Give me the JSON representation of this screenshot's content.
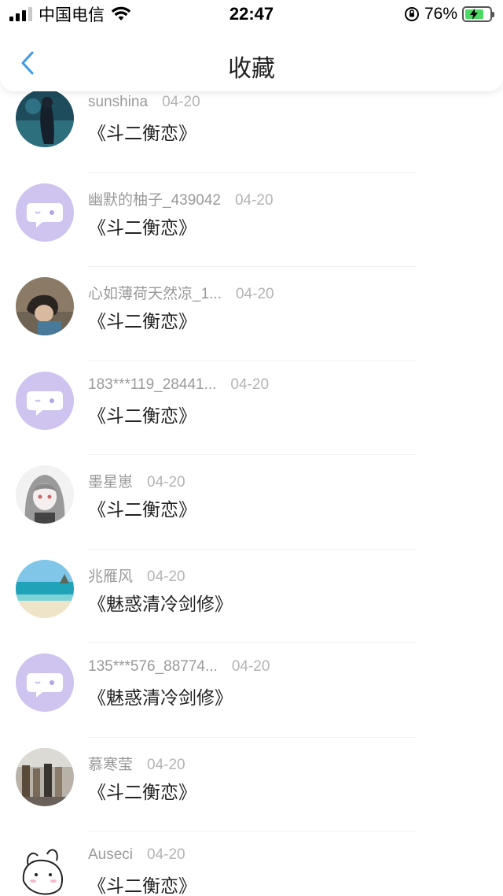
{
  "status_bar": {
    "carrier": "中国电信",
    "time": "22:47",
    "battery": "76%",
    "battery_level": 0.76
  },
  "header": {
    "title": "收藏",
    "back_icon": "chevron-left-icon"
  },
  "colors": {
    "accent": "#3d9be9",
    "placeholder_avatar": "#cfc3ef"
  },
  "items": [
    {
      "user": "sunshina",
      "date": "04-20",
      "title": "《斗二衡恋》",
      "avatar": "photo-dark-water"
    },
    {
      "user": "幽默的柚子_439042",
      "date": "04-20",
      "title": "《斗二衡恋》",
      "avatar": "default-chat-bubble"
    },
    {
      "user": "心如薄荷天然凉_1...",
      "date": "04-20",
      "title": "《斗二衡恋》",
      "avatar": "photo-person"
    },
    {
      "user": "183***119_28441...",
      "date": "04-20",
      "title": "《斗二衡恋》",
      "avatar": "default-chat-bubble"
    },
    {
      "user": "墨星崽",
      "date": "04-20",
      "title": "《斗二衡恋》",
      "avatar": "anime-girl-grey"
    },
    {
      "user": "兆雁风",
      "date": "04-20",
      "title": "《魅惑清冷剑修》",
      "avatar": "photo-beach"
    },
    {
      "user": "135***576_88774...",
      "date": "04-20",
      "title": "《魅惑清冷剑修》",
      "avatar": "default-chat-bubble"
    },
    {
      "user": "慕寒莹",
      "date": "04-20",
      "title": "《斗二衡恋》",
      "avatar": "photo-crowd"
    },
    {
      "user": "Auseci",
      "date": "04-20",
      "title": "《斗二衡恋》",
      "avatar": "sketch-bunny"
    }
  ]
}
